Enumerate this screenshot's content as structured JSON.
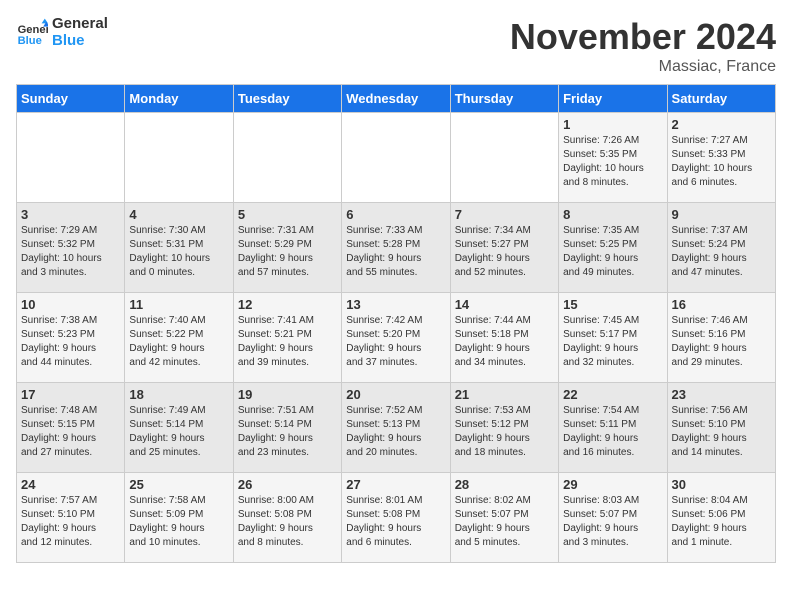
{
  "logo": {
    "line1": "General",
    "line2": "Blue"
  },
  "title": "November 2024",
  "location": "Massiac, France",
  "weekdays": [
    "Sunday",
    "Monday",
    "Tuesday",
    "Wednesday",
    "Thursday",
    "Friday",
    "Saturday"
  ],
  "weeks": [
    [
      {
        "day": "",
        "info": ""
      },
      {
        "day": "",
        "info": ""
      },
      {
        "day": "",
        "info": ""
      },
      {
        "day": "",
        "info": ""
      },
      {
        "day": "",
        "info": ""
      },
      {
        "day": "1",
        "info": "Sunrise: 7:26 AM\nSunset: 5:35 PM\nDaylight: 10 hours\nand 8 minutes."
      },
      {
        "day": "2",
        "info": "Sunrise: 7:27 AM\nSunset: 5:33 PM\nDaylight: 10 hours\nand 6 minutes."
      }
    ],
    [
      {
        "day": "3",
        "info": "Sunrise: 7:29 AM\nSunset: 5:32 PM\nDaylight: 10 hours\nand 3 minutes."
      },
      {
        "day": "4",
        "info": "Sunrise: 7:30 AM\nSunset: 5:31 PM\nDaylight: 10 hours\nand 0 minutes."
      },
      {
        "day": "5",
        "info": "Sunrise: 7:31 AM\nSunset: 5:29 PM\nDaylight: 9 hours\nand 57 minutes."
      },
      {
        "day": "6",
        "info": "Sunrise: 7:33 AM\nSunset: 5:28 PM\nDaylight: 9 hours\nand 55 minutes."
      },
      {
        "day": "7",
        "info": "Sunrise: 7:34 AM\nSunset: 5:27 PM\nDaylight: 9 hours\nand 52 minutes."
      },
      {
        "day": "8",
        "info": "Sunrise: 7:35 AM\nSunset: 5:25 PM\nDaylight: 9 hours\nand 49 minutes."
      },
      {
        "day": "9",
        "info": "Sunrise: 7:37 AM\nSunset: 5:24 PM\nDaylight: 9 hours\nand 47 minutes."
      }
    ],
    [
      {
        "day": "10",
        "info": "Sunrise: 7:38 AM\nSunset: 5:23 PM\nDaylight: 9 hours\nand 44 minutes."
      },
      {
        "day": "11",
        "info": "Sunrise: 7:40 AM\nSunset: 5:22 PM\nDaylight: 9 hours\nand 42 minutes."
      },
      {
        "day": "12",
        "info": "Sunrise: 7:41 AM\nSunset: 5:21 PM\nDaylight: 9 hours\nand 39 minutes."
      },
      {
        "day": "13",
        "info": "Sunrise: 7:42 AM\nSunset: 5:20 PM\nDaylight: 9 hours\nand 37 minutes."
      },
      {
        "day": "14",
        "info": "Sunrise: 7:44 AM\nSunset: 5:18 PM\nDaylight: 9 hours\nand 34 minutes."
      },
      {
        "day": "15",
        "info": "Sunrise: 7:45 AM\nSunset: 5:17 PM\nDaylight: 9 hours\nand 32 minutes."
      },
      {
        "day": "16",
        "info": "Sunrise: 7:46 AM\nSunset: 5:16 PM\nDaylight: 9 hours\nand 29 minutes."
      }
    ],
    [
      {
        "day": "17",
        "info": "Sunrise: 7:48 AM\nSunset: 5:15 PM\nDaylight: 9 hours\nand 27 minutes."
      },
      {
        "day": "18",
        "info": "Sunrise: 7:49 AM\nSunset: 5:14 PM\nDaylight: 9 hours\nand 25 minutes."
      },
      {
        "day": "19",
        "info": "Sunrise: 7:51 AM\nSunset: 5:14 PM\nDaylight: 9 hours\nand 23 minutes."
      },
      {
        "day": "20",
        "info": "Sunrise: 7:52 AM\nSunset: 5:13 PM\nDaylight: 9 hours\nand 20 minutes."
      },
      {
        "day": "21",
        "info": "Sunrise: 7:53 AM\nSunset: 5:12 PM\nDaylight: 9 hours\nand 18 minutes."
      },
      {
        "day": "22",
        "info": "Sunrise: 7:54 AM\nSunset: 5:11 PM\nDaylight: 9 hours\nand 16 minutes."
      },
      {
        "day": "23",
        "info": "Sunrise: 7:56 AM\nSunset: 5:10 PM\nDaylight: 9 hours\nand 14 minutes."
      }
    ],
    [
      {
        "day": "24",
        "info": "Sunrise: 7:57 AM\nSunset: 5:10 PM\nDaylight: 9 hours\nand 12 minutes."
      },
      {
        "day": "25",
        "info": "Sunrise: 7:58 AM\nSunset: 5:09 PM\nDaylight: 9 hours\nand 10 minutes."
      },
      {
        "day": "26",
        "info": "Sunrise: 8:00 AM\nSunset: 5:08 PM\nDaylight: 9 hours\nand 8 minutes."
      },
      {
        "day": "27",
        "info": "Sunrise: 8:01 AM\nSunset: 5:08 PM\nDaylight: 9 hours\nand 6 minutes."
      },
      {
        "day": "28",
        "info": "Sunrise: 8:02 AM\nSunset: 5:07 PM\nDaylight: 9 hours\nand 5 minutes."
      },
      {
        "day": "29",
        "info": "Sunrise: 8:03 AM\nSunset: 5:07 PM\nDaylight: 9 hours\nand 3 minutes."
      },
      {
        "day": "30",
        "info": "Sunrise: 8:04 AM\nSunset: 5:06 PM\nDaylight: 9 hours\nand 1 minute."
      }
    ]
  ]
}
